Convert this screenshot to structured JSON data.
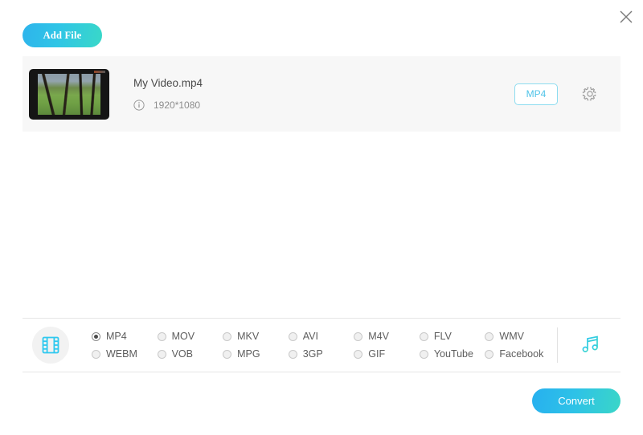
{
  "window": {
    "close_label": "×",
    "close_icon": "close-icon"
  },
  "toolbar": {
    "add_file_label": "Add File"
  },
  "file_list": [
    {
      "name": "My Video.mp4",
      "resolution": "1920*1080",
      "info_icon": "info-circle-icon",
      "output_format": "MP4",
      "settings_icon": "gear-icon",
      "thumbnail_alt": "forest video thumbnail"
    }
  ],
  "format_panel": {
    "video_icon": "film-strip-icon",
    "audio_icon": "music-note-icon",
    "selected_format": "MP4",
    "options": [
      {
        "label": "MP4",
        "selected": true
      },
      {
        "label": "MOV",
        "selected": false
      },
      {
        "label": "MKV",
        "selected": false
      },
      {
        "label": "AVI",
        "selected": false
      },
      {
        "label": "M4V",
        "selected": false
      },
      {
        "label": "FLV",
        "selected": false
      },
      {
        "label": "WMV",
        "selected": false
      },
      {
        "label": "WEBM",
        "selected": false
      },
      {
        "label": "VOB",
        "selected": false
      },
      {
        "label": "MPG",
        "selected": false
      },
      {
        "label": "3GP",
        "selected": false
      },
      {
        "label": "GIF",
        "selected": false
      },
      {
        "label": "YouTube",
        "selected": false
      },
      {
        "label": "Facebook",
        "selected": false
      }
    ]
  },
  "actions": {
    "convert_label": "Convert"
  },
  "colors": {
    "accent_start": "#27b0ef",
    "accent_end": "#3ad6c7",
    "cyan_icon": "#2ec8ef",
    "badge_border": "#8ddcf0",
    "row_background": "#f7f7f7",
    "panel_border": "#e6e6e6"
  }
}
